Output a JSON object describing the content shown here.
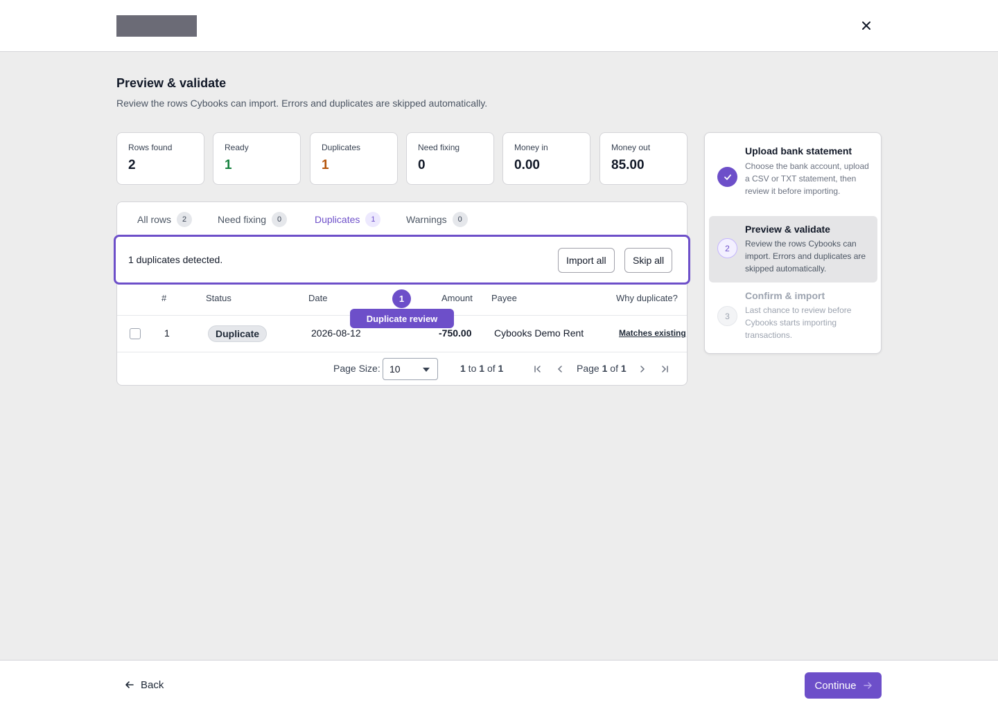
{
  "header": {
    "close_icon": "close-icon"
  },
  "page": {
    "title": "Preview & validate",
    "subtitle": "Review the rows Cybooks can import. Errors and duplicates are skipped automatically."
  },
  "stats": [
    {
      "label": "Rows found",
      "value": "2",
      "color": "#111827"
    },
    {
      "label": "Ready",
      "value": "1",
      "color": "#15803d"
    },
    {
      "label": "Duplicates",
      "value": "1",
      "color": "#b45309"
    },
    {
      "label": "Need fixing",
      "value": "0",
      "color": "#111827"
    },
    {
      "label": "Money in",
      "value": "0.00",
      "color": "#111827"
    },
    {
      "label": "Money out",
      "value": "85.00",
      "color": "#111827"
    }
  ],
  "tabs": [
    {
      "label": "All rows",
      "count": "2",
      "active": false
    },
    {
      "label": "Need fixing",
      "count": "0",
      "active": false
    },
    {
      "label": "Duplicates",
      "count": "1",
      "active": true
    },
    {
      "label": "Warnings",
      "count": "0",
      "active": false
    }
  ],
  "duplicates_bar": {
    "message": "1 duplicates detected.",
    "import_all_label": "Import all",
    "skip_all_label": "Skip all"
  },
  "table": {
    "columns": [
      "#",
      "Status",
      "Date",
      "Amount",
      "Payee",
      "Why duplicate?"
    ],
    "rows": [
      {
        "index": "1",
        "status": "Duplicate",
        "date": "2026-08-12",
        "amount": "-750.00",
        "payee": "Cybooks Demo Rent",
        "why": "Matches existing transaction"
      }
    ]
  },
  "tour": {
    "step_number": "1",
    "tooltip": "Duplicate review"
  },
  "pagination": {
    "page_size_label": "Page Size:",
    "page_size": "10",
    "range_start": "1",
    "range_to": " to ",
    "range_end": "1",
    "range_of": " of ",
    "range_total": "1",
    "page_prefix": "Page ",
    "page_current": "1",
    "page_of": " of ",
    "page_total": "1"
  },
  "steps": [
    {
      "number": "",
      "title": "Upload bank statement",
      "description": "Choose the bank account, upload a CSV or TXT statement, then review it before importing.",
      "state": "done"
    },
    {
      "number": "2",
      "title": "Preview & validate",
      "description": "Review the rows Cybooks can import. Errors and duplicates are skipped automatically.",
      "state": "active"
    },
    {
      "number": "3",
      "title": "Confirm & import",
      "description": "Last chance to review before Cybooks starts importing transactions.",
      "state": "pending"
    }
  ],
  "footer": {
    "back_label": "Back",
    "continue_label": "Continue"
  },
  "colors": {
    "accent": "#6d4fc9",
    "ready": "#15803d",
    "duplicate": "#b45309"
  }
}
